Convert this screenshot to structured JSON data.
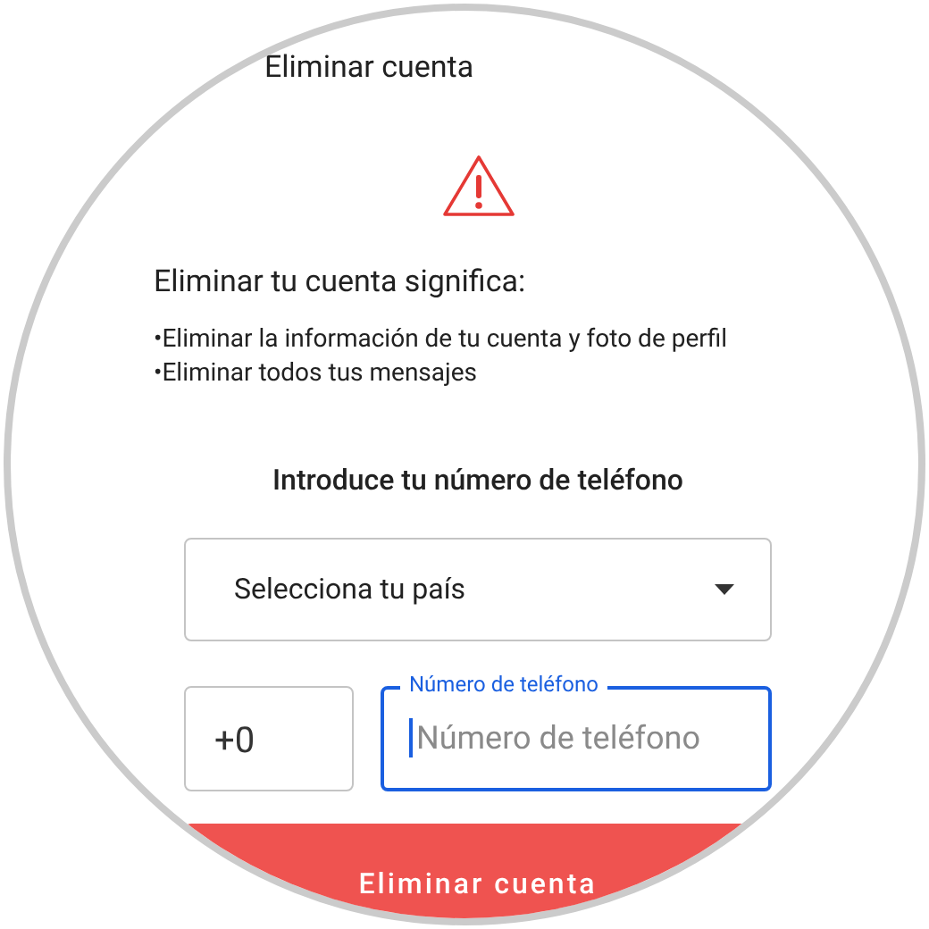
{
  "title": "Eliminar cuenta",
  "intro": "Eliminar tu cuenta significa:",
  "bullets": [
    "•Eliminar la información de tu cuenta y foto de perfil",
    "•Eliminar todos tus mensajes"
  ],
  "prompt": "Introduce tu número de teléfono",
  "country_select": {
    "placeholder": "Selecciona tu país"
  },
  "country_code": {
    "value": "+0"
  },
  "phone_field": {
    "label": "Número de teléfono",
    "placeholder": "Número de teléfono",
    "focused": true
  },
  "submit_button": {
    "label": "Eliminar cuenta"
  }
}
